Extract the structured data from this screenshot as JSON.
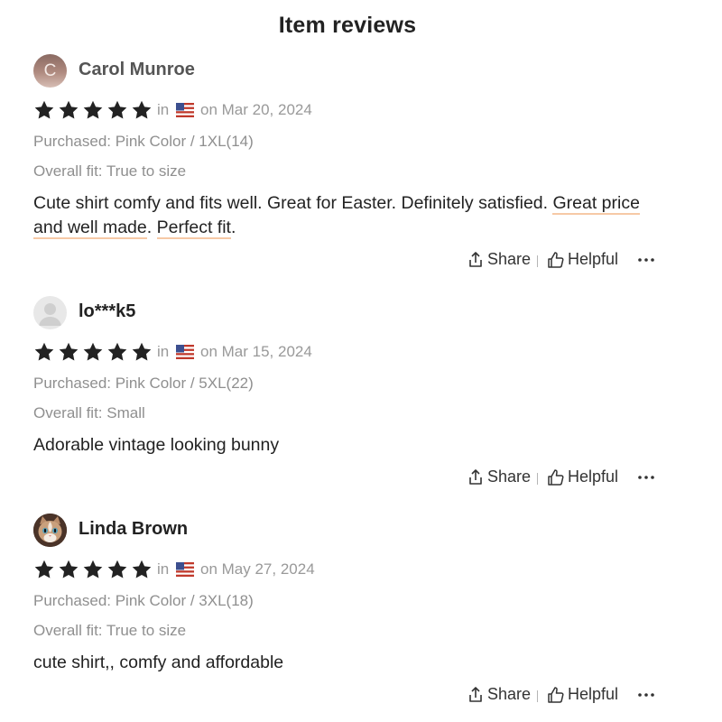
{
  "page": {
    "title": "Item reviews"
  },
  "colors": {
    "star": "#222222",
    "meta": "#999999",
    "highlight_underline": "#f6c9a6"
  },
  "reviews": [
    {
      "avatar": {
        "type": "letter",
        "letter": "C"
      },
      "name": "Carol Munroe",
      "rating": 5,
      "in_label": "in",
      "country_flag": "us-flag-icon",
      "date": "on Mar 20, 2024",
      "purchased": "Purchased: Pink Color / 1XL(14)",
      "fit": "Overall fit: True to size",
      "body_parts": [
        "Cute shirt comfy and fits well. Great for Easter. Definitely satisfied. ",
        "Great price and well made",
        ". ",
        "Perfect fit",
        "."
      ],
      "share_label": "Share",
      "helpful_label": "Helpful"
    },
    {
      "avatar": {
        "type": "default"
      },
      "name": "lo***k5",
      "rating": 5,
      "in_label": "in",
      "country_flag": "us-flag-icon",
      "date": "on Mar 15, 2024",
      "purchased": "Purchased: Pink Color / 5XL(22)",
      "fit": "Overall fit: Small",
      "body": "Adorable vintage looking bunny",
      "share_label": "Share",
      "helpful_label": "Helpful"
    },
    {
      "avatar": {
        "type": "cat-photo"
      },
      "name": "Linda Brown",
      "rating": 5,
      "in_label": "in",
      "country_flag": "us-flag-icon",
      "date": "on May 27, 2024",
      "purchased": "Purchased: Pink Color / 3XL(18)",
      "fit": "Overall fit: True to size",
      "body": "cute shirt,, comfy and affordable",
      "share_label": "Share",
      "helpful_label": "Helpful"
    }
  ]
}
